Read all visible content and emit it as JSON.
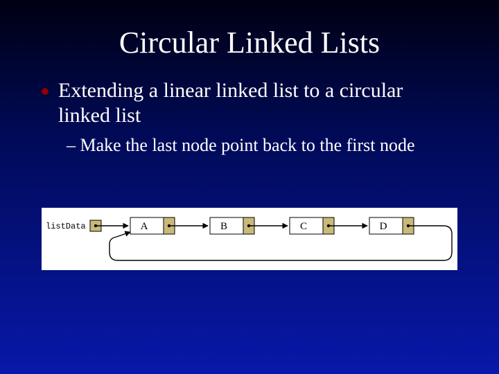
{
  "title": "Circular Linked Lists",
  "bullet": "Extending a linear linked list to a circular linked list",
  "sub_prefix": "– ",
  "sub": "Make the last node point back to the first node",
  "diagram": {
    "head_label": "listData",
    "nodes": [
      "A",
      "B",
      "C",
      "D"
    ]
  }
}
